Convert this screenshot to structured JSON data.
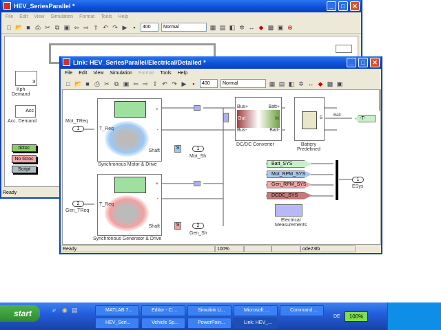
{
  "back_window": {
    "title": "HEV_SeriesParallel *",
    "menu": [
      "File",
      "Edit",
      "View",
      "Simulation",
      "Format",
      "Tools",
      "Help"
    ],
    "stop_time": "400",
    "sim_mode": "Normal",
    "status": "Ready",
    "blocks": {
      "kph_label": "Kph\nDemand",
      "kph_value": "3",
      "acc_inner": "Acc",
      "acc_label": "Acc. Demand",
      "tictoc": "tictoc",
      "no_tictoc": "No tictoc",
      "script": "Script"
    }
  },
  "front_window": {
    "title": "Link: HEV_SeriesParallel/Electrical/Detailed *",
    "menu": [
      "File",
      "Edit",
      "View",
      "Simulation",
      "Format",
      "Tools",
      "Help"
    ],
    "stop_time": "400",
    "sim_mode": "Normal",
    "status": {
      "text": "Ready",
      "zoom": "100%",
      "solver": "ode23tb"
    },
    "diagram": {
      "motor": {
        "label": "Synchronous Motor & Drive",
        "in_port": "1",
        "in_name": "Mot_TReq",
        "t_req": "T_Req",
        "shaft": "Shaft",
        "out_port": "1",
        "out_name": "Mot_Sh",
        "s": "S",
        "plus": "+",
        "minus": "-"
      },
      "generator": {
        "label": "Synchronous Generator & Drive",
        "in_port": "2",
        "in_name": "Gen_TReq",
        "t_req": "T_Req",
        "shaft": "Shaft",
        "out_port": "2",
        "out_name": "Gen_Sh",
        "s": "S",
        "plus": "+",
        "minus": "-"
      },
      "dcdc": {
        "label": "DC/DC Converter",
        "bus_plus": "Bus+",
        "bus_minus": "Bus-",
        "batt_plus": "Batt+",
        "batt_minus": "Batt-",
        "out": "Out",
        "in": "In"
      },
      "battery": {
        "label": "Battery\nPredefined",
        "s": "S",
        "plus": "+",
        "minus": "-"
      },
      "batt_signal": "Batt",
      "goto_tag": "-T-",
      "bus_tags": [
        {
          "label": "Batt_SYS",
          "color": "#c8f0c8"
        },
        {
          "label": "Mot_RPM_SYS",
          "color": "#a8c8f0"
        },
        {
          "label": "Gen_RPM_SYS",
          "color": "#f0a8a8"
        },
        {
          "label": "DCDC_SYS",
          "color": "#c87878"
        }
      ],
      "esys_port": "1",
      "esys_name": "ESys",
      "measurements_label": "Electrical\nMeasurements"
    }
  },
  "taskbar": {
    "start": "start",
    "buttons_top": [
      "MATLAB 7...",
      "Editor - C:...",
      "Simulink Li...",
      "Microsoft ...",
      "Command ..."
    ],
    "buttons_bottom": [
      "HEV_Seri...",
      "Vehicle Sp...",
      "PowerPoin...",
      "Link: HEV_..."
    ],
    "lang": "DE",
    "battery": "100%"
  }
}
